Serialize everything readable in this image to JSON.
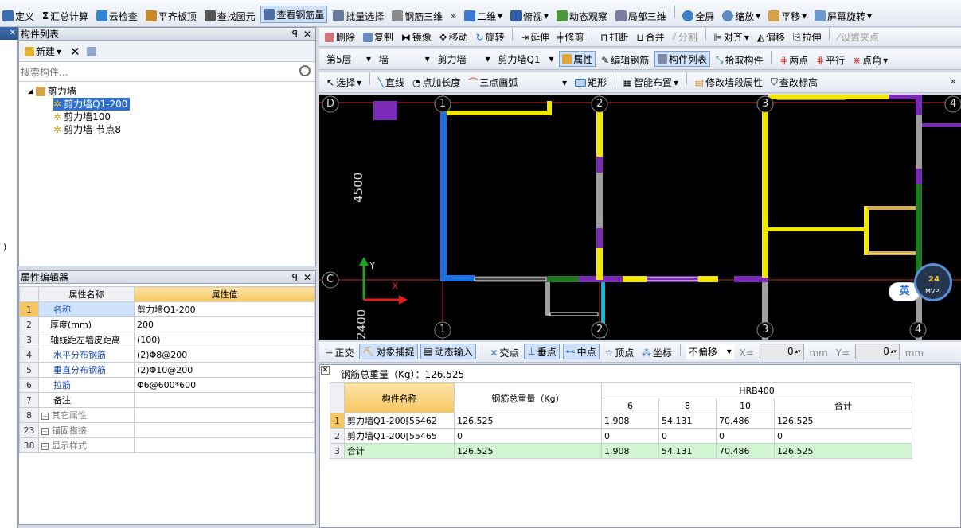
{
  "toolbar1": {
    "items": [
      "定义",
      "汇总计算",
      "云检查",
      "平齐板顶",
      "查找图元",
      "查看钢筋量",
      "批量选择",
      "钢筋三维",
      "二维",
      "俯视",
      "动态观察",
      "局部三维",
      "全屏",
      "缩放",
      "平移",
      "屏幕旋转"
    ]
  },
  "toolbar2": {
    "items": [
      "删除",
      "复制",
      "镜像",
      "移动",
      "旋转",
      "延伸",
      "修剪",
      "打断",
      "合并",
      "分割",
      "对齐",
      "偏移",
      "拉伸",
      "设置夹点"
    ]
  },
  "toolbar3": {
    "floor": "第5层",
    "type": "墙",
    "subtype": "剪力墙",
    "component": "剪力墙Q1",
    "items": [
      "属性",
      "编辑钢筋",
      "构件列表",
      "拾取构件",
      "两点",
      "平行",
      "点角"
    ]
  },
  "toolbar4": {
    "items": [
      "选择",
      "直线",
      "点加长度",
      "三点画弧",
      "矩形",
      "智能布置",
      "修改墙段属性",
      "查改标高"
    ]
  },
  "component_list": {
    "title": "构件列表",
    "new_label": "新建",
    "search_placeholder": "搜索构件...",
    "tree_root": "剪力墙",
    "tree_children": [
      "剪力墙Q1-200",
      "剪力墙100",
      "剪力墙-节点8"
    ]
  },
  "property_editor": {
    "title": "属性编辑器",
    "col_name": "属性名称",
    "col_value": "属性值",
    "rows": [
      {
        "num": "1",
        "name": "名称",
        "value": "剪力墙Q1-200"
      },
      {
        "num": "2",
        "name": "厚度(mm)",
        "value": "200"
      },
      {
        "num": "3",
        "name": "轴线距左墙皮距离",
        "value": "(100)"
      },
      {
        "num": "4",
        "name": "水平分布钢筋",
        "value": "(2)Φ8@200"
      },
      {
        "num": "5",
        "name": "垂直分布钢筋",
        "value": "(2)Φ10@200"
      },
      {
        "num": "6",
        "name": "拉筋",
        "value": "Φ6@600*600"
      },
      {
        "num": "7",
        "name": "备注",
        "value": ""
      },
      {
        "num": "8",
        "name": "其它属性",
        "value": ""
      },
      {
        "num": "23",
        "name": "锚固搭接",
        "value": ""
      },
      {
        "num": "38",
        "name": "显示样式",
        "value": ""
      }
    ]
  },
  "canvas": {
    "axis_labels": [
      "D",
      "C",
      "1",
      "1",
      "2",
      "2",
      "3",
      "3",
      "4",
      "4"
    ],
    "dims": [
      "4500",
      "2400"
    ],
    "ucs_y": "Y",
    "ucs_x": "X",
    "ime": "英",
    "avatar_text": "MVP",
    "avatar_num": "24"
  },
  "snapbar": {
    "items": [
      "正交",
      "对象捕捉",
      "动态输入",
      "交点",
      "垂点",
      "中点",
      "顶点",
      "坐标"
    ],
    "offset_mode": "不偏移",
    "x_label": "X=",
    "x_value": "0",
    "y_label": "Y=",
    "y_value": "0",
    "unit": "mm"
  },
  "results": {
    "total_label": "钢筋总重量（Kg）：126.525",
    "col_name": "构件名称",
    "col_total": "钢筋总重量（Kg）",
    "group": "HRB400",
    "sub_cols": [
      "6",
      "8",
      "10",
      "合计"
    ],
    "rows": [
      {
        "num": "1",
        "name": "剪力墙Q1-200[55462",
        "total": "126.525",
        "c6": "1.908",
        "c8": "54.131",
        "c10": "70.486",
        "sum": "126.525"
      },
      {
        "num": "2",
        "name": "剪力墙Q1-200[55465",
        "total": "0",
        "c6": "0",
        "c8": "0",
        "c10": "0",
        "sum": "0"
      },
      {
        "num": "3",
        "name": "合计",
        "total": "126.525",
        "c6": "1.908",
        "c8": "54.131",
        "c10": "70.486",
        "sum": "126.525"
      }
    ]
  }
}
